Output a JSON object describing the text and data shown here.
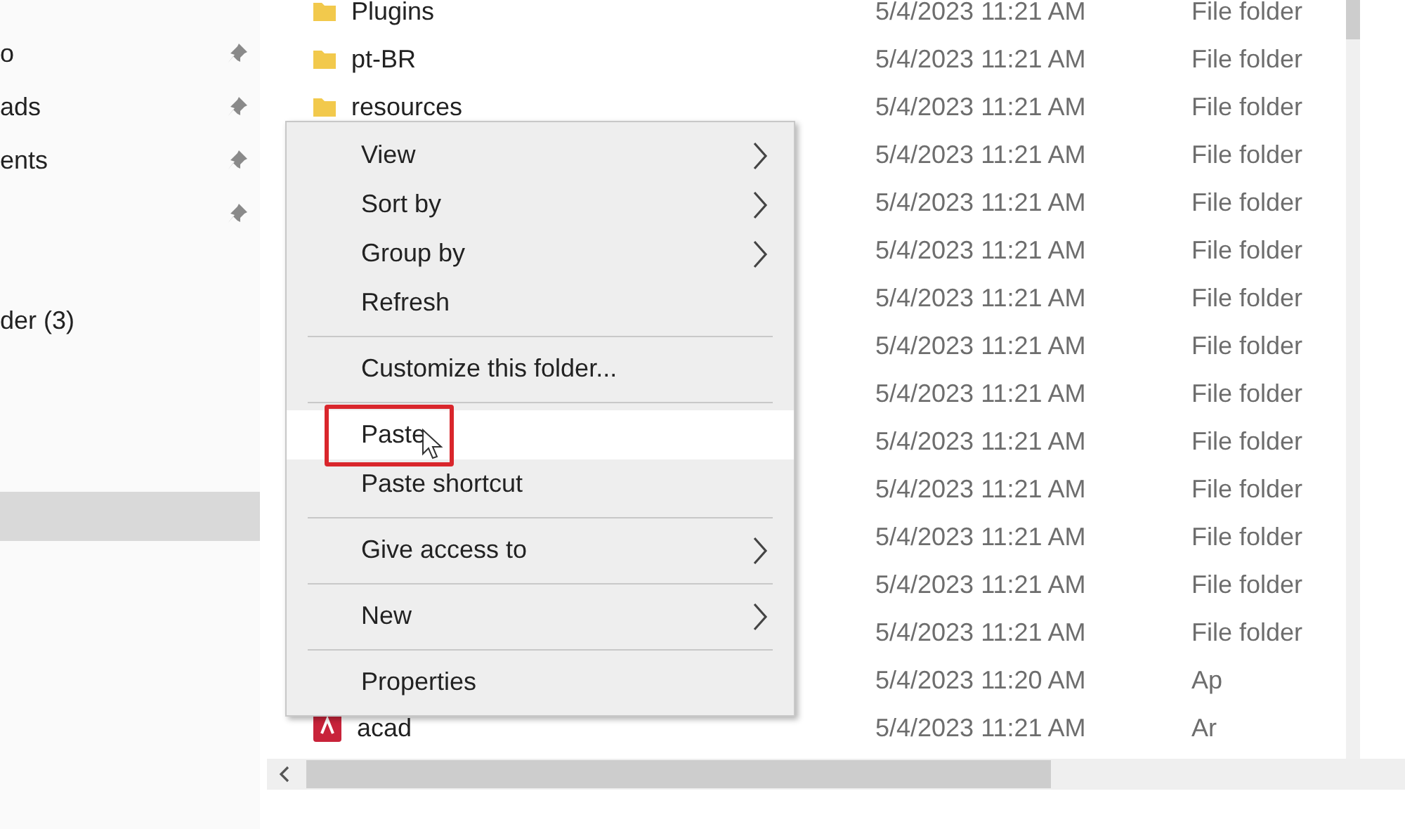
{
  "sidebar": {
    "items": [
      {
        "label": "o",
        "kind": "item",
        "pinned": true,
        "selected": false
      },
      {
        "label": "ads",
        "kind": "item",
        "pinned": true,
        "selected": false
      },
      {
        "label": "ents",
        "kind": "item",
        "pinned": true,
        "selected": false
      },
      {
        "kind": "item",
        "pinned": true,
        "selected": false
      },
      {
        "label": "der (3)",
        "kind": "group",
        "pinned": false,
        "selected": false
      },
      {
        "kind": "item",
        "pinned": false,
        "selected": true
      }
    ]
  },
  "file_list": {
    "rows": [
      {
        "name": "Plugins",
        "kind": "folder",
        "date": "5/4/2023 11:21 AM",
        "type": "File folder"
      },
      {
        "name": "pt-BR",
        "kind": "folder",
        "date": "5/4/2023 11:21 AM",
        "type": "File folder"
      },
      {
        "name": "resources",
        "kind": "folder",
        "date": "5/4/2023 11:21 AM",
        "type": "File folder"
      },
      {
        "date": "5/4/2023 11:21 AM",
        "type": "File folder"
      },
      {
        "date": "5/4/2023 11:21 AM",
        "type": "File folder"
      },
      {
        "date": "5/4/2023 11:21 AM",
        "type": "File folder"
      },
      {
        "date": "5/4/2023 11:21 AM",
        "type": "File folder"
      },
      {
        "date": "5/4/2023 11:21 AM",
        "type": "File folder"
      },
      {
        "date": "5/4/2023 11:21 AM",
        "type": "File folder"
      },
      {
        "date": "5/4/2023 11:21 AM",
        "type": "File folder"
      },
      {
        "date": "5/4/2023 11:21 AM",
        "type": "File folder"
      },
      {
        "date": "5/4/2023 11:21 AM",
        "type": "File folder"
      },
      {
        "date": "5/4/2023 11:21 AM",
        "type": "File folder"
      },
      {
        "date": "5/4/2023 11:21 AM",
        "type": "File folder"
      },
      {
        "date": "5/4/2023 11:20 AM",
        "type": "Ap"
      },
      {
        "name": "acad",
        "kind": "app",
        "date": "5/4/2023 11:21 AM",
        "type": "Ar"
      }
    ]
  },
  "context_menu": {
    "items": [
      {
        "kind": "item",
        "label": "View",
        "submenu": true,
        "hovered": false,
        "highlighted": false
      },
      {
        "kind": "item",
        "label": "Sort by",
        "submenu": true,
        "hovered": false,
        "highlighted": false
      },
      {
        "kind": "item",
        "label": "Group by",
        "submenu": true,
        "hovered": false,
        "highlighted": false
      },
      {
        "kind": "item",
        "label": "Refresh",
        "submenu": false,
        "hovered": false,
        "highlighted": false
      },
      {
        "kind": "separator"
      },
      {
        "kind": "item",
        "label": "Customize this folder...",
        "submenu": false,
        "hovered": false,
        "highlighted": false
      },
      {
        "kind": "separator"
      },
      {
        "kind": "item",
        "label": "Paste",
        "submenu": false,
        "hovered": true,
        "highlighted": true
      },
      {
        "kind": "item",
        "label": "Paste shortcut",
        "submenu": false,
        "hovered": false,
        "highlighted": false
      },
      {
        "kind": "separator"
      },
      {
        "kind": "item",
        "label": "Give access to",
        "submenu": true,
        "hovered": false,
        "highlighted": false
      },
      {
        "kind": "separator"
      },
      {
        "kind": "item",
        "label": "New",
        "submenu": true,
        "hovered": false,
        "highlighted": false
      },
      {
        "kind": "separator"
      },
      {
        "kind": "item",
        "label": "Properties",
        "submenu": false,
        "hovered": false,
        "highlighted": false
      }
    ]
  }
}
